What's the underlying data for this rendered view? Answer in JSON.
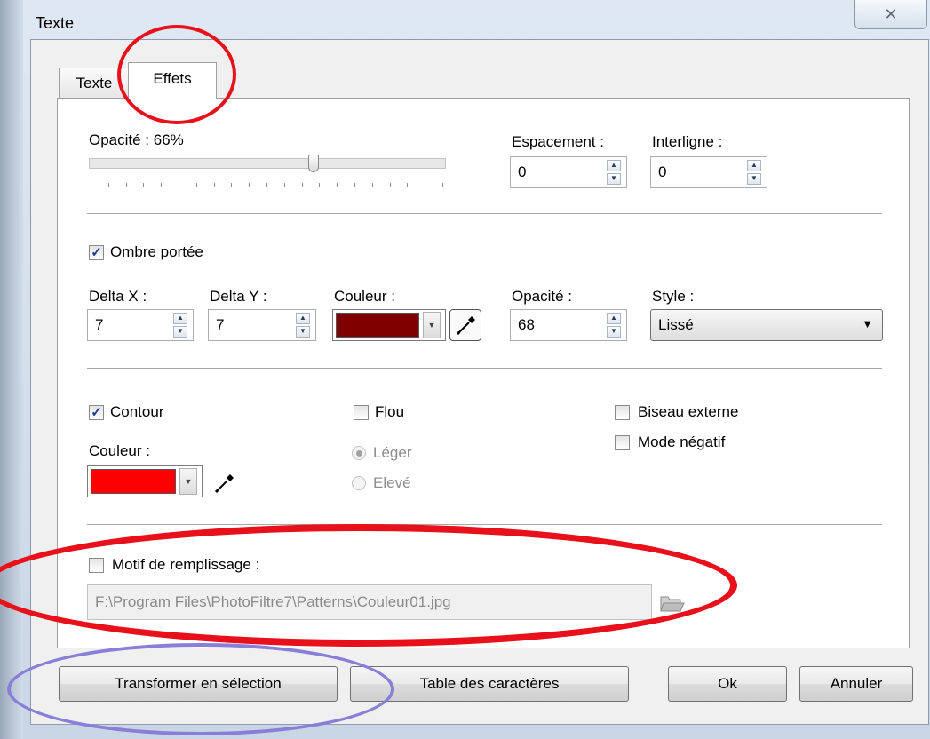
{
  "window": {
    "title": "Texte",
    "close_icon": "✕"
  },
  "tabs": [
    {
      "label": "Texte"
    },
    {
      "label": "Effets"
    }
  ],
  "effects": {
    "opacity_label": "Opacité : 66%",
    "opacity_value": 0.66,
    "spacing_label": "Espacement :",
    "spacing_value": "0",
    "line_spacing_label": "Interligne :",
    "line_spacing_value": "0"
  },
  "shadow": {
    "checkbox_label": "Ombre portée",
    "checked": true,
    "delta_x_label": "Delta X :",
    "delta_x_value": "7",
    "delta_y_label": "Delta Y :",
    "delta_y_value": "7",
    "color_label": "Couleur :",
    "color": "#800000",
    "opacity_label": "Opacité :",
    "opacity_value": "68",
    "style_label": "Style :",
    "style_value": "Lissé"
  },
  "outline": {
    "checkbox_label": "Contour",
    "checked": true,
    "color_label": "Couleur :",
    "color": "#ff0000"
  },
  "blur": {
    "checkbox_label": "Flou",
    "checked": false,
    "light_label": "Léger",
    "high_label": "Elevé"
  },
  "bevel": {
    "label": "Biseau externe",
    "checked": false
  },
  "negative": {
    "label": "Mode négatif",
    "checked": false
  },
  "pattern": {
    "checkbox_label": "Motif de remplissage :",
    "checked": false,
    "path": "F:\\Program Files\\PhotoFiltre7\\Patterns\\Couleur01.jpg"
  },
  "buttons": {
    "transform": "Transformer en sélection",
    "char_table": "Table des caractères",
    "ok": "Ok",
    "cancel": "Annuler"
  },
  "annotation_colors": {
    "red": "#e8101a",
    "blue": "#8a7fd8"
  },
  "icons": {
    "check": "✓",
    "spin_up": "▲",
    "spin_down": "▼",
    "dropdown": "▼",
    "close": "close-icon",
    "eyedropper": "eyedropper-icon",
    "folder": "folder-open-icon"
  }
}
